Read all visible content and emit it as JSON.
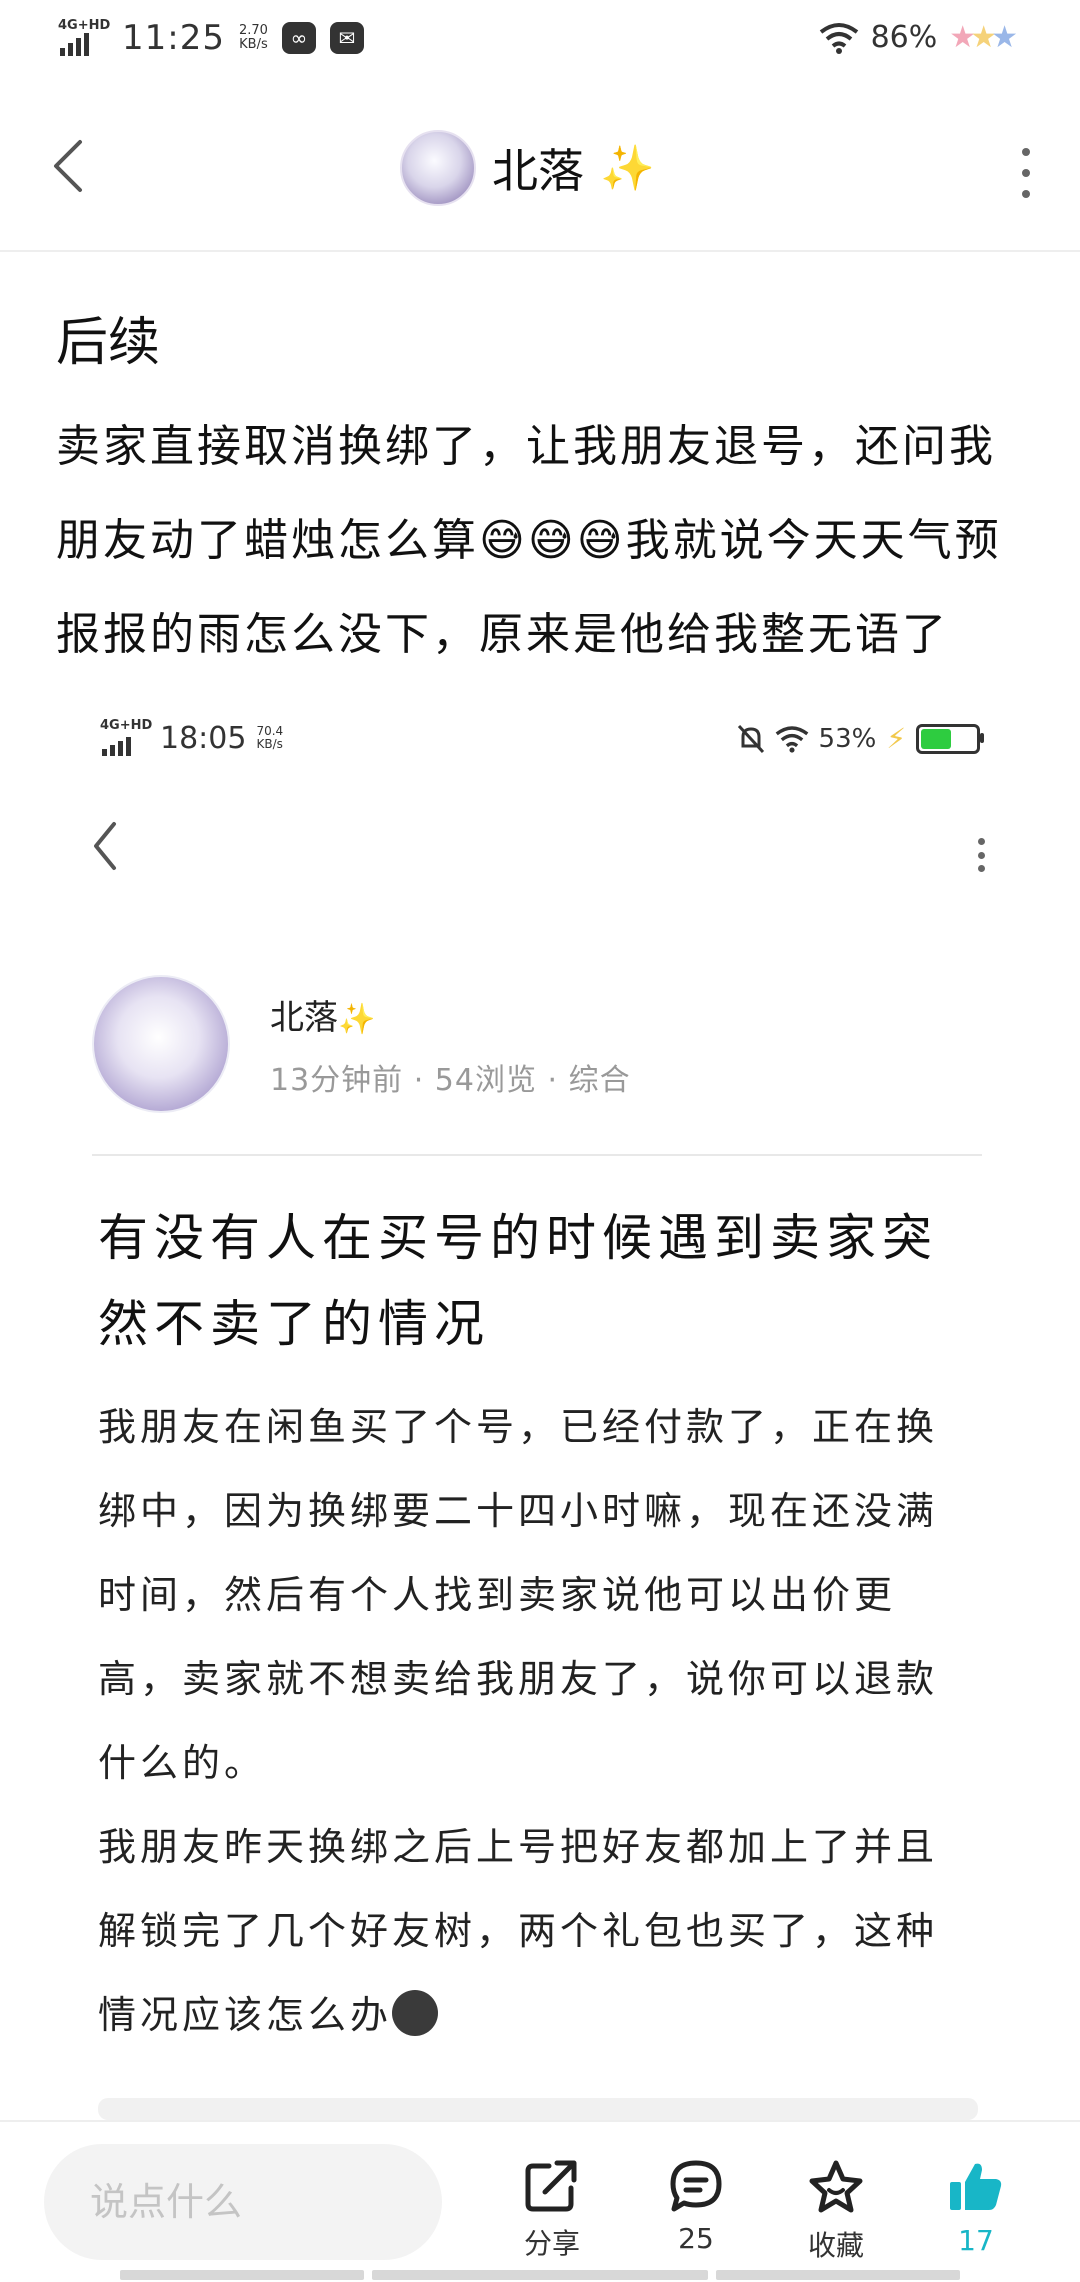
{
  "status_bar": {
    "network": "4G+HD",
    "time": "11:25",
    "speed_value": "2.70",
    "speed_unit": "KB/s",
    "battery": "86%"
  },
  "header": {
    "name": "北落",
    "sparkle": "✨"
  },
  "post": {
    "title": "后续",
    "body_part1": "卖家直接取消换绑了，让我朋友退号，还问我朋友动了蜡烛怎么算",
    "emojis": "😅😅😅",
    "body_part2": "我就说今天天气预报报的雨怎么没下，原来是他给我整无语了"
  },
  "embedded": {
    "status_bar": {
      "network": "4G+HD",
      "time": "18:05",
      "speed_value": "70.4",
      "speed_unit": "KB/s",
      "battery": "53%"
    },
    "author": {
      "name": "北落",
      "sparkle": "✨",
      "meta": "13分钟前 · 54浏览 · 综合"
    },
    "title": "有没有人在买号的时候遇到卖家突然不卖了的情况",
    "paragraph1": "我朋友在闲鱼买了个号，已经付款了，正在换绑中，因为换绑要二十四小时嘛，现在还没满时间，然后有个人找到卖家说他可以出价更高，卖家就不想卖给我朋友了，说你可以退款什么的。",
    "paragraph2": "我朋友昨天换绑之后上号把好友都加上了并且解锁完了几个好友树，两个礼包也买了，这种情况应该怎么办"
  },
  "bottom_bar": {
    "comment_placeholder": "说点什么",
    "share_label": "分享",
    "comment_count": "25",
    "favorite_label": "收藏",
    "like_count": "17"
  },
  "colors": {
    "accent": "#18b6c7",
    "sparkle": "#f2c94c",
    "battery_fill": "#2ecc40"
  }
}
